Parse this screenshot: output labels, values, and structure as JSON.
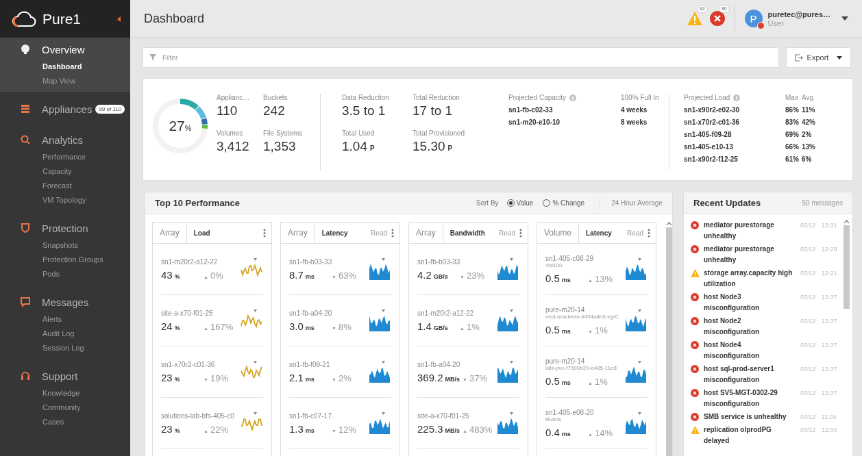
{
  "app": {
    "name": "Pure1"
  },
  "sidebar": {
    "sections": [
      {
        "title": "Overview",
        "selected": true,
        "items": [
          {
            "label": "Dashboard",
            "selected": true
          },
          {
            "label": "Map View",
            "selected": false
          }
        ]
      },
      {
        "title": "Appliances",
        "selected": false,
        "badge": "99 of 110"
      },
      {
        "title": "Analytics",
        "selected": false,
        "items": [
          {
            "label": "Performance",
            "selected": false
          },
          {
            "label": "Capacity",
            "selected": false
          },
          {
            "label": "Forecast",
            "selected": false
          },
          {
            "label": "VM Topology",
            "selected": false
          }
        ]
      },
      {
        "title": "Protection",
        "selected": false,
        "items": [
          {
            "label": "Snapshots",
            "selected": false
          },
          {
            "label": "Protection Groups",
            "selected": false
          },
          {
            "label": "Pods",
            "selected": false
          }
        ]
      },
      {
        "title": "Messages",
        "selected": false,
        "items": [
          {
            "label": "Alerts",
            "selected": false
          },
          {
            "label": "Audit Log",
            "selected": false
          },
          {
            "label": "Session Log",
            "selected": false
          }
        ]
      },
      {
        "title": "Support",
        "selected": false,
        "items": [
          {
            "label": "Knowledge",
            "selected": false
          },
          {
            "label": "Community",
            "selected": false
          },
          {
            "label": "Cases",
            "selected": false
          }
        ]
      }
    ]
  },
  "header": {
    "title": "Dashboard",
    "alerts": [
      {
        "kind": "warning",
        "count": "92"
      },
      {
        "kind": "error",
        "count": "90"
      }
    ],
    "user": {
      "initial": "P",
      "name": "puretec@pures…",
      "role": "User"
    }
  },
  "filter": {
    "placeholder": "Filter"
  },
  "export_button": "Export",
  "stats": {
    "gauge": {
      "value": "27",
      "unit": "%"
    },
    "counts": [
      {
        "label": "Applianc…",
        "value": "110"
      },
      {
        "label": "Buckets",
        "value": "242"
      },
      {
        "label": "Volumes",
        "value": "3,412"
      },
      {
        "label": "File Systems",
        "value": "1,353"
      }
    ],
    "reductions": [
      {
        "label": "Data Reduction",
        "value": "3.5 to 1"
      },
      {
        "label": "Total Reduction",
        "value": "17 to 1"
      },
      {
        "label": "Total Used",
        "value": "1.04",
        "unit": "P"
      },
      {
        "label": "Total Provisioned",
        "value": "15.30",
        "unit": "P"
      }
    ],
    "projected_capacity": {
      "title": "Projected Capacity",
      "column": "100% Full In",
      "rows": [
        {
          "name": "sn1-fb-c02-33",
          "value": "4 weeks"
        },
        {
          "name": "sn1-m20-e10-10",
          "value": "8 weeks"
        }
      ]
    },
    "projected_load": {
      "title": "Projected Load",
      "columns": [
        "Max",
        "Avg"
      ],
      "rows": [
        {
          "name": "sn1-x90r2-e02-30",
          "max": "86%",
          "avg": "11%"
        },
        {
          "name": "sn1-x70r2-c01-36",
          "max": "83%",
          "avg": "42%"
        },
        {
          "name": "sn1-405-f09-28",
          "max": "69%",
          "avg": "2%"
        },
        {
          "name": "sn1-405-e10-13",
          "max": "66%",
          "avg": "13%"
        },
        {
          "name": "sn1-x90r2-f12-25",
          "max": "61%",
          "avg": "6%"
        }
      ]
    }
  },
  "performance": {
    "title": "Top 10 Performance",
    "sort_label": "Sort By",
    "sort_options": [
      {
        "label": "Value",
        "selected": true
      },
      {
        "label": "% Change",
        "selected": false
      }
    ],
    "period": "24 Hour Average",
    "columns": [
      {
        "entity": "Array",
        "metric": "Load",
        "color": "#d4a21c",
        "rows": [
          {
            "name": "sn1-m20r2-a12-22",
            "value": "43",
            "unit": "%",
            "arrow": "▲",
            "change": "0%"
          },
          {
            "name": "site-a-x70-f01-25",
            "value": "24",
            "unit": "%",
            "arrow": "▲",
            "change": "167%"
          },
          {
            "name": "sn1-x70r2-c01-36",
            "value": "23",
            "unit": "%",
            "arrow": "▼",
            "change": "19%"
          },
          {
            "name": "solutions-lab-bfs-405-c0",
            "value": "23",
            "unit": "%",
            "arrow": "▲",
            "change": "22%"
          }
        ]
      },
      {
        "entity": "Array",
        "metric": "Latency",
        "mode": "Read",
        "color": "#1f8ad2",
        "rows": [
          {
            "name": "sn1-fb-b03-33",
            "value": "8.7",
            "unit": "ms",
            "arrow": "▼",
            "change": "63%"
          },
          {
            "name": "sn1-fb-a04-20",
            "value": "3.0",
            "unit": "ms",
            "arrow": "▼",
            "change": "8%"
          },
          {
            "name": "sn1-fb-f09-21",
            "value": "2.1",
            "unit": "ms",
            "arrow": "▼",
            "change": "2%"
          },
          {
            "name": "sn1-fb-c07-17",
            "value": "1.3",
            "unit": "ms",
            "arrow": "▼",
            "change": "12%"
          }
        ]
      },
      {
        "entity": "Array",
        "metric": "Bandwidth",
        "mode": "Read",
        "color": "#1f8ad2",
        "rows": [
          {
            "name": "sn1-fb-b03-33",
            "value": "4.2",
            "unit": "GB/s",
            "arrow": "▼",
            "change": "23%"
          },
          {
            "name": "sn1-m20r2-a12-22",
            "value": "1.4",
            "unit": "GB/s",
            "arrow": "▲",
            "change": "1%"
          },
          {
            "name": "sn1-fb-a04-20",
            "value": "369.2",
            "unit": "MB/s",
            "arrow": "▼",
            "change": "37%"
          },
          {
            "name": "site-a-x70-f01-25",
            "value": "225.3",
            "unit": "MB/s",
            "arrow": "▲",
            "change": "483%"
          }
        ]
      },
      {
        "entity": "Volume",
        "metric": "Latency",
        "mode": "Read",
        "color": "#1f8ad2",
        "rows": [
          {
            "name": "sn1-405-c08-29",
            "detail": "Vol100",
            "value": "0.5",
            "unit": "ms",
            "arrow": "▲",
            "change": "13%"
          },
          {
            "name": "pure-m20-14",
            "detail": "vvol-oraclevm-4454a4b5-vg/C",
            "value": "0.5",
            "unit": "ms",
            "arrow": "▼",
            "change": "1%"
          },
          {
            "name": "pure-m20-14",
            "detail": "k8s-pvc-f7500b20-e485-11e8",
            "value": "0.5",
            "unit": "ms",
            "arrow": "▲",
            "change": "1%"
          },
          {
            "name": "sn1-405-e08-20",
            "detail": "Rubrik",
            "value": "0.4",
            "unit": "ms",
            "arrow": "▲",
            "change": "14%"
          }
        ]
      }
    ]
  },
  "recent_updates": {
    "title": "Recent Updates",
    "count": "50 messages",
    "items": [
      {
        "kind": "error",
        "text": "mediator purestorage unhealthy",
        "date": "07/12",
        "time": "12:31"
      },
      {
        "kind": "error",
        "text": "mediator purestorage unhealthy",
        "date": "07/12",
        "time": "12:29"
      },
      {
        "kind": "warning",
        "text": "storage array.capacity high utilization",
        "date": "07/12",
        "time": "12:21"
      },
      {
        "kind": "error",
        "text": "host Node3 misconfiguration",
        "date": "07/12",
        "time": "12:37"
      },
      {
        "kind": "error",
        "text": "host Node2 misconfiguration",
        "date": "07/12",
        "time": "12:37"
      },
      {
        "kind": "error",
        "text": "host Node4 misconfiguration",
        "date": "07/12",
        "time": "12:37"
      },
      {
        "kind": "error",
        "text": "host sql-prod-server1 misconfiguration",
        "date": "07/12",
        "time": "12:37"
      },
      {
        "kind": "error",
        "text": "host SV5-MGT-0302-29 misconfiguration",
        "date": "07/12",
        "time": "12:37"
      },
      {
        "kind": "error",
        "text": "SMB service is unhealthy",
        "date": "07/12",
        "time": "11:04"
      },
      {
        "kind": "warning",
        "text": "replication olprodPG delayed",
        "date": "07/12",
        "time": "12:00"
      }
    ]
  }
}
